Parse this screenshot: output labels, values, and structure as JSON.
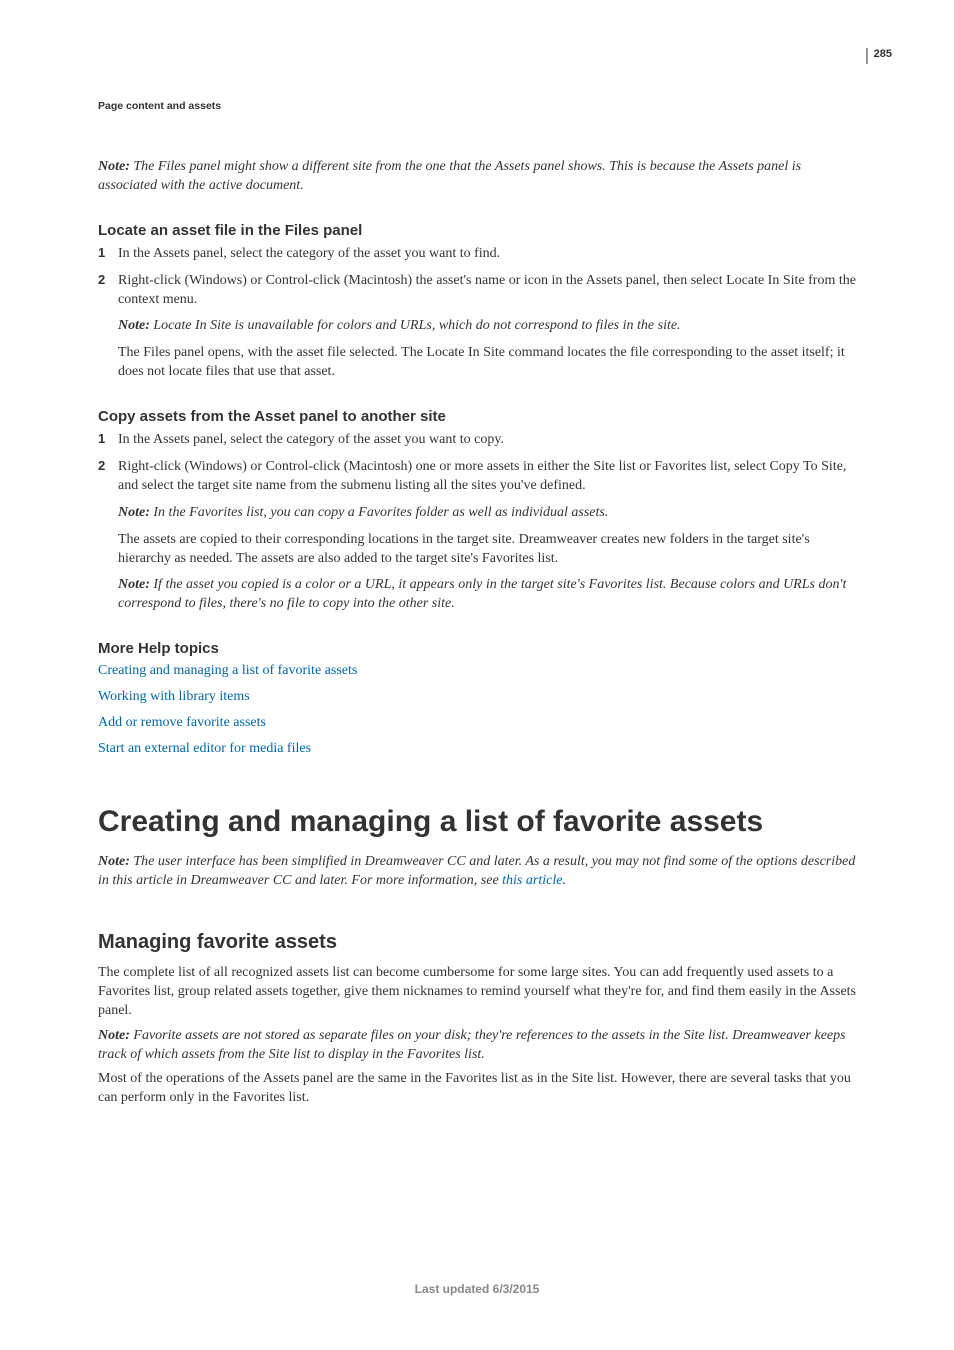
{
  "page_number": "285",
  "header": "Page content and assets",
  "intro_note": {
    "label": "Note:",
    "text": " The Files panel might show a different site from the one that the Assets panel shows. This is because the Assets panel is associated with the active document."
  },
  "section1": {
    "heading": "Locate an asset file in the Files panel",
    "items": [
      {
        "num": "1",
        "text": "In the Assets panel, select the category of the asset you want to find."
      },
      {
        "num": "2",
        "text": "Right-click (Windows) or Control-click (Macintosh) the asset's name or icon in the Assets panel, then select Locate In Site from the context menu.",
        "note_label": "Note:",
        "note_text": " Locate In Site is unavailable for colors and URLs, which do not correspond to files in the site.",
        "after": "The Files panel opens, with the asset file selected. The Locate In Site command locates the file corresponding to the asset itself; it does not locate files that use that asset."
      }
    ]
  },
  "section2": {
    "heading": "Copy assets from the Asset panel to another site",
    "items": [
      {
        "num": "1",
        "text": "In the Assets panel, select the category of the asset you want to copy."
      },
      {
        "num": "2",
        "text": "Right-click (Windows) or Control-click (Macintosh) one or more assets in either the Site list or Favorites list, select Copy To Site, and select the target site name from the submenu listing all the sites you've defined.",
        "note1_label": "Note:",
        "note1_text": " In the Favorites list, you can copy a Favorites folder as well as individual assets.",
        "mid": "The assets are copied to their corresponding locations in the target site. Dreamweaver creates new folders in the target site's hierarchy as needed. The assets are also added to the target site's Favorites list.",
        "note2_label": "Note:",
        "note2_text": " If the asset you copied is a color or a URL, it appears only in the target site's Favorites list. Because colors and URLs don't correspond to files, there's no file to copy into the other site."
      }
    ]
  },
  "more_help": {
    "heading": "More Help topics",
    "links": [
      "Creating and managing a list of favorite assets",
      "Working with library items",
      "Add or remove favorite assets",
      "Start an external editor for media files"
    ]
  },
  "main_heading": "Creating and managing a list of favorite assets",
  "main_note": {
    "label": "Note:",
    "text_before": " The user interface has been simplified in Dreamweaver CC and later. As a result, you may not find some of the options described in this article in Dreamweaver CC and later. For more information, see ",
    "link": "this article",
    "text_after": "."
  },
  "managing": {
    "heading": "Managing favorite assets",
    "p1": "The complete list of all recognized assets list can become cumbersome for some large sites. You can add frequently used assets to a Favorites list, group related assets together, give them nicknames to remind yourself what they're for, and find them easily in the Assets panel.",
    "note_label": "Note:",
    "note_text": " Favorite assets are not stored as separate files on your disk; they're references to the assets in the Site list. Dreamweaver keeps track of which assets from the Site list to display in the Favorites list.",
    "p2": "Most of the operations of the Assets panel are the same in the Favorites list as in the Site list. However, there are several tasks that you can perform only in the Favorites list."
  },
  "footer": "Last updated 6/3/2015"
}
